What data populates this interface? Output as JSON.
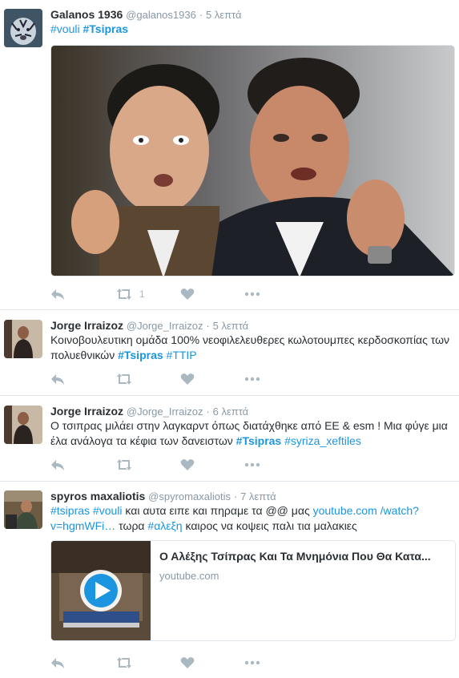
{
  "colors": {
    "link": "#1b95e0",
    "meta": "#8899a6",
    "icon": "#aab8c2",
    "text": "#292f33",
    "divider": "#e1e8ed"
  },
  "tweets": [
    {
      "name": "Galanos 1936",
      "handle": "@galanos1936",
      "dot": "·",
      "time": "5 λεπτά",
      "hashtag1": "#vouli",
      "hashtag2": "#Tsipras",
      "retweet_count": "1"
    },
    {
      "name": "Jorge Irraizoz",
      "handle": "@Jorge_Irraizoz",
      "dot": "·",
      "time": "5 λεπτά",
      "text1": "Κοινοβουλευτικη ομάδα 100% νεοφιλελευθερες κωλοτουμπες κερδοσκοπίας των πολυεθνικών ",
      "hashtag1": "#Tsipras",
      "hashtag2": "#TTIP"
    },
    {
      "name": "Jorge Irraizoz",
      "handle": "@Jorge_Irraizoz",
      "dot": "·",
      "time": "6 λεπτά",
      "text1": "Ο τσιπρας μιλάει στην λαγκαρντ όπως διατάχθηκε από ΕΕ & esm ! Μια φύγε μια έλα ανάλογα τα κέφια των δανειστων ",
      "hashtag1": "#Tsipras",
      "hashtag2": "#syriza_xeftiles"
    },
    {
      "name": "spyros maxaliotis",
      "handle": "@spyromaxaliotis",
      "dot": "·",
      "time": "7 λεπτά",
      "hashtag1": "#tsipras",
      "hashtag2": "#vouli",
      "text1": " και αυτα ειπε  και πηραμε τα @@ μας ",
      "link1": "youtube.com",
      "link2": "/watch?v=hgmWFi…",
      "text2": " τωρα ",
      "hashtag3": "#αλεξη",
      "text3": " καιρος να κοψεις παλι τια μαλακιες",
      "card_title": "Ο Αλέξης Τσίπρας Και Τα Μνημόνια Που Θα Κατα...",
      "card_domain": "youtube.com"
    }
  ]
}
